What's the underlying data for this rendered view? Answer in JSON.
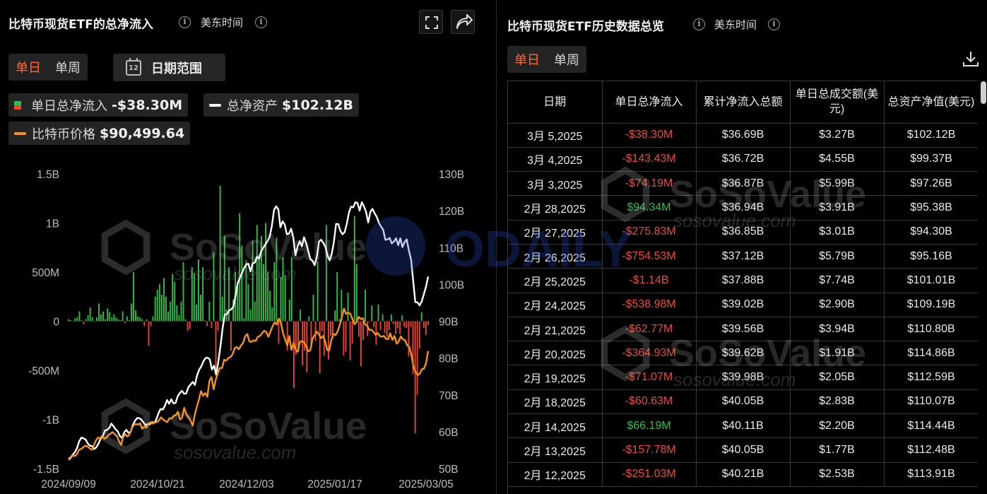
{
  "left_panel": {
    "title": "比特币现货ETF的总净流入",
    "timezone": "美东时间",
    "tabs": [
      {
        "label": "单日",
        "active": true
      },
      {
        "label": "单周",
        "active": false
      }
    ],
    "date_range_label": "日期范围",
    "calendar_day": "12",
    "legend": {
      "net_inflow": {
        "label": "单日总净流入",
        "value": "-$38.30M"
      },
      "net_assets": {
        "label": "总净资产",
        "value": "$102.12B",
        "color": "#ffffff"
      },
      "btc_price": {
        "label": "比特币价格",
        "value": "$90,499.64",
        "color": "#f7931a"
      }
    }
  },
  "right_panel": {
    "title": "比特币现货ETF历史数据总览",
    "timezone": "美东时间",
    "tabs": [
      {
        "label": "单日",
        "active": true
      },
      {
        "label": "单周",
        "active": false
      }
    ],
    "table": {
      "headers": [
        "日期",
        "单日总净流入",
        "累计净流入总额",
        "单日总成交额(美元)",
        "总资产净值(美元)"
      ],
      "rows": [
        [
          "3月 5,2025",
          "-$38.30M",
          "$36.69B",
          "$3.27B",
          "$102.12B"
        ],
        [
          "3月 4,2025",
          "-$143.43M",
          "$36.72B",
          "$4.55B",
          "$99.37B"
        ],
        [
          "3月 3,2025",
          "-$74.19M",
          "$36.87B",
          "$5.99B",
          "$97.26B"
        ],
        [
          "2月 28,2025",
          "$94.34M",
          "$36.94B",
          "$3.91B",
          "$95.38B"
        ],
        [
          "2月 27,2025",
          "-$275.83M",
          "$36.85B",
          "$3.01B",
          "$94.30B"
        ],
        [
          "2月 26,2025",
          "-$754.53M",
          "$37.12B",
          "$5.79B",
          "$95.16B"
        ],
        [
          "2月 25,2025",
          "-$1.14B",
          "$37.88B",
          "$7.74B",
          "$101.01B"
        ],
        [
          "2月 24,2025",
          "-$538.98M",
          "$39.02B",
          "$2.90B",
          "$109.19B"
        ],
        [
          "2月 21,2025",
          "-$62.77M",
          "$39.56B",
          "$3.94B",
          "$110.80B"
        ],
        [
          "2月 20,2025",
          "-$364.93M",
          "$39.62B",
          "$1.91B",
          "$114.86B"
        ],
        [
          "2月 19,2025",
          "-$71.07M",
          "$39.98B",
          "$2.05B",
          "$112.59B"
        ],
        [
          "2月 18,2025",
          "-$60.63M",
          "$40.05B",
          "$2.83B",
          "$110.07B"
        ],
        [
          "2月 14,2025",
          "$66.19M",
          "$40.11B",
          "$2.20B",
          "$114.44B"
        ],
        [
          "2月 13,2025",
          "-$157.78M",
          "$40.05B",
          "$1.77B",
          "$112.48B"
        ],
        [
          "2月 12,2025",
          "-$251.03M",
          "$40.21B",
          "$2.53B",
          "$113.91B"
        ]
      ]
    }
  },
  "watermarks": {
    "brand": "SoSoValue",
    "site": "sosovalue.com",
    "odaily": "ODAILY"
  },
  "chart_data": {
    "type": "bar",
    "x_ticks": [
      "2024/09/09",
      "2024/10/21",
      "2024/12/03",
      "2025/01/17",
      "2025/03/05"
    ],
    "left_axis": {
      "ticks": [
        "1.5B",
        "1B",
        "500M",
        "0",
        "-500M",
        "-1B",
        "-1.5B"
      ],
      "range": [
        -1.5,
        1.5
      ]
    },
    "right_axis": {
      "ticks": [
        "130B",
        "120B",
        "110B",
        "100B",
        "90B",
        "80B",
        "70B",
        "60B",
        "50B"
      ],
      "range": [
        50,
        130
      ]
    },
    "colors": {
      "positive": "#2fbf45",
      "negative": "#e84535",
      "net_assets": "#ffffff",
      "btc_price": "#f7931a"
    },
    "bars_b": [
      0.02,
      0.01,
      0.0,
      0.03,
      0.04,
      0.1,
      0.01,
      -0.03,
      0.02,
      0.06,
      0.14,
      0.04,
      0.0,
      0.04,
      0.18,
      0.07,
      0.1,
      0.02,
      0.13,
      0.09,
      0.04,
      0.07,
      0.04,
      0.02,
      0.01,
      0.1,
      -0.02,
      0.05,
      0.01,
      0.18,
      0.5,
      0.11,
      0.05,
      0.04,
      0.02,
      -0.05,
      0.02,
      -0.25,
      -0.05,
      0.05,
      0.25,
      0.32,
      0.38,
      0.27,
      0.44,
      0.25,
      0.1,
      0.2,
      0.48,
      0.4,
      0.16,
      0.06,
      0.2,
      0.6,
      0.02,
      -0.1,
      -0.08,
      0.55,
      0.49,
      0.17,
      0.63,
      0.27,
      0.55,
      0.01,
      -0.05,
      0.2,
      -0.07,
      0.7,
      -0.54,
      -0.1,
      1.38,
      0.25,
      0.87,
      0.12,
      0.55,
      -0.3,
      0.22,
      0.5,
      0.38,
      1.1,
      0.77,
      0.03,
      0.62,
      0.38,
      0.12,
      0.82,
      0.2,
      0.98,
      0.68,
      0.87,
      0.58,
      1.0,
      0.5,
      0.31,
      0.14,
      0.6,
      0.85,
      -0.23,
      0.45,
      0.65,
      0.47,
      -0.3,
      0.22,
      0.65,
      -0.68,
      -0.34,
      -0.3,
      0.12,
      -0.45,
      -0.3,
      -0.52,
      0.05,
      -0.27,
      0.27,
      -0.2,
      0.61,
      -0.53,
      -0.1,
      -0.35,
      0.98,
      -0.39,
      -0.15,
      -0.18,
      0.11,
      0.5,
      0.02,
      0.32,
      -0.35,
      -0.31,
      0.29,
      -0.4,
      -0.23,
      1.07,
      0.58,
      -0.16,
      -0.46,
      -0.19,
      0.32,
      -0.15,
      -0.01,
      0.16,
      -0.06,
      -0.24,
      0.17,
      -0.09,
      0.07,
      -0.12,
      -0.16,
      -0.09,
      0.07,
      -0.03,
      -0.13,
      -0.07,
      -0.13,
      0.06,
      -0.06,
      -0.07,
      -0.36,
      -0.06,
      -0.54,
      -1.14,
      -0.75,
      -0.28,
      0.09,
      -0.07,
      -0.14,
      -0.04
    ],
    "net_assets_b": [
      52.7,
      53.0,
      53.8,
      54.5,
      55.6,
      57.4,
      58.4,
      58.2,
      57.9,
      56.8,
      56.2,
      56.1,
      55.3,
      55.8,
      56.8,
      58.1,
      58.8,
      60.3,
      60.5,
      61.0,
      62.2,
      61.5,
      60.6,
      60.1,
      58.8,
      58.3,
      59.8,
      60.5,
      59.7,
      60.0,
      61.8,
      62.9,
      63.7,
      63.7,
      63.3,
      62.5,
      61.8,
      62.1,
      62.0,
      62.6,
      62.4,
      63.3,
      65.0,
      66.2,
      66.0,
      67.0,
      68.6,
      67.6,
      68.8,
      67.7,
      67.8,
      69.6,
      70.5,
      71.1,
      70.3,
      70.4,
      72.1,
      72.8,
      73.5,
      72.7,
      75.2,
      76.8,
      77.7,
      79.1,
      80.0,
      80.1,
      79.6,
      76.9,
      77.9,
      75.4,
      79.2,
      83.3,
      88.1,
      91.8,
      91.9,
      92.9,
      93.2,
      93.9,
      96.8,
      100.3,
      101.7,
      103.0,
      104.4,
      105.4,
      105.6,
      103.5,
      105.7,
      105.9,
      107.5,
      107.0,
      109.0,
      110.0,
      110.8,
      111.8,
      113.0,
      115.9,
      120.2,
      121.2,
      120.4,
      115.5,
      117.1,
      116.2,
      113.6,
      113.8,
      115.1,
      112.7,
      107.9,
      110.3,
      111.7,
      110.3,
      112.8,
      111.2,
      109.0,
      106.8,
      106.4,
      105.2,
      107.5,
      111.6,
      112.1,
      111.3,
      110.2,
      107.8,
      106.5,
      108.4,
      111.7,
      116.4,
      116.4,
      114.5,
      113.6,
      114.2,
      116.5,
      119.5,
      121.1,
      120.9,
      122.3,
      122.1,
      120.0,
      122.3,
      121.2,
      119.7,
      116.8,
      119.7,
      120.5,
      119.3,
      118.3,
      116.7,
      115.7,
      114.8,
      112.1,
      112.2,
      112.6,
      111.1,
      111.6,
      112.5,
      110.6,
      112.5,
      110.1,
      111.5,
      112.2,
      109.2,
      106.8,
      101.0,
      95.2,
      95.1,
      94.3,
      95.4,
      97.3,
      99.4,
      102.1
    ],
    "btc_price_b": [
      52.3,
      52.8,
      53.6,
      53.4,
      53.9,
      55.1,
      55.3,
      55.8,
      56.2,
      56.0,
      55.5,
      55.1,
      56.2,
      57.6,
      58.4,
      58.2,
      58.9,
      58.1,
      58.4,
      59.1,
      59.5,
      59.9,
      59.3,
      58.8,
      57.4,
      56.4,
      58.6,
      59.3,
      58.7,
      59.2,
      60.9,
      61.8,
      62.1,
      61.9,
      62.3,
      60.8,
      61.4,
      61.1,
      62.1,
      62.6,
      62.2,
      62.5,
      62.6,
      63.1,
      63.9,
      63.3,
      62.9,
      62.6,
      63.7,
      63.5,
      64.3,
      64.5,
      65.4,
      63.3,
      63.8,
      66.5,
      64.8,
      63.9,
      63.1,
      61.6,
      64.5,
      66.8,
      68.7,
      71.0,
      69.8,
      70.5,
      69.5,
      73.8,
      74.8,
      71.5,
      74.1,
      75.9,
      77.3,
      77.3,
      79.5,
      79.3,
      80.0,
      80.3,
      81.0,
      82.7,
      83.0,
      82.4,
      83.4,
      84.1,
      85.9,
      86.5,
      84.5,
      84.4,
      84.8,
      84.6,
      85.8,
      86.0,
      86.7,
      87.4,
      87.1,
      85.8,
      87.1,
      88.6,
      89.7,
      89.1,
      90.7,
      89.6,
      86.8,
      85.1,
      83.4,
      86.0,
      82.2,
      84.1,
      82.3,
      81.7,
      84.4,
      84.6,
      84.2,
      83.1,
      81.8,
      82.1,
      85.3,
      86.2,
      87.2,
      86.5,
      85.4,
      86.0,
      84.6,
      82.2,
      82.1,
      85.0,
      86.6,
      86.2,
      87.3,
      89.0,
      91.2,
      93.4,
      92.0,
      92.3,
      92.0,
      90.6,
      89.2,
      89.8,
      91.2,
      90.6,
      90.8,
      89.1,
      88.8,
      87.6,
      87.7,
      87.1,
      86.3,
      86.8,
      86.0,
      85.8,
      86.0,
      85.2,
      85.1,
      86.7,
      84.9,
      86.0,
      83.9,
      84.5,
      85.9,
      85.1,
      84.8,
      83.5,
      83.0,
      80.9,
      77.7,
      76.3,
      75.4,
      75.7,
      77.0,
      77.1,
      78.6,
      81.9
    ]
  }
}
